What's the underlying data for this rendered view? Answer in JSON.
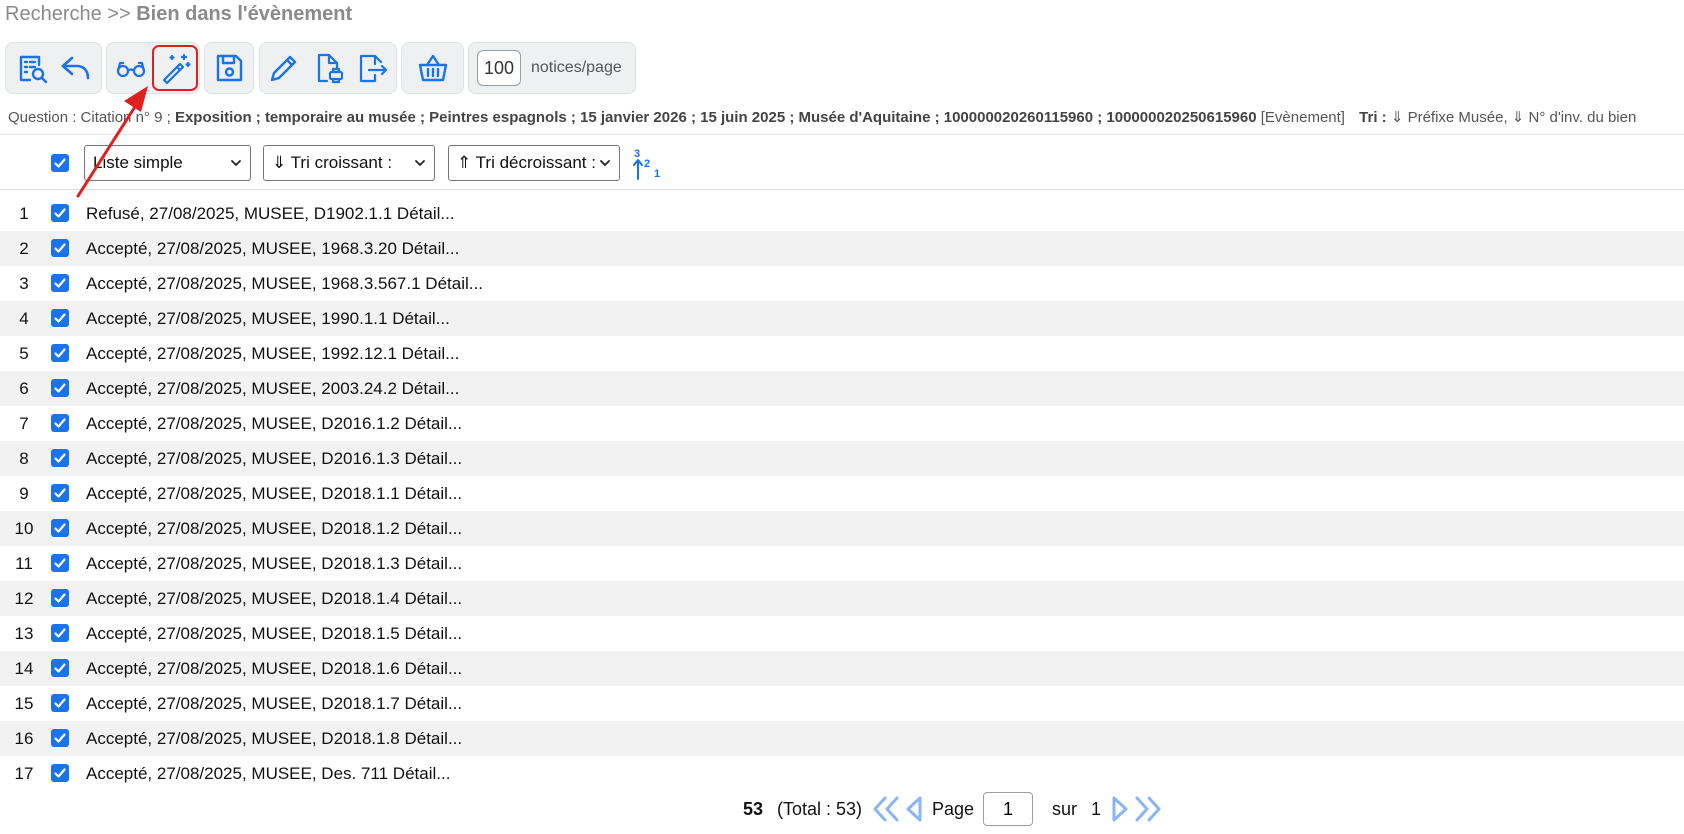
{
  "breadcrumb": {
    "root": "Recherche",
    "separator": ">>",
    "current": "Bien dans l'évènement"
  },
  "toolbar": {
    "icons": [
      "list-search-icon",
      "undo-icon",
      "glasses-icon",
      "magic-wand-icon",
      "save-icon",
      "pencil-icon",
      "file-print-icon",
      "export-icon",
      "basket-icon"
    ],
    "per_page_value": "100",
    "per_page_label": "notices/page"
  },
  "question": {
    "prefix": "Question : Citation n° 9 ;",
    "terms": "Exposition ; temporaire au musée ; Peintres espagnols ; 15 janvier 2026 ; 15 juin 2025 ; Musée d'Aquitaine ; 100000020260115960 ; 100000020250615960",
    "context": "[Evènement]",
    "tri_label": "Tri :",
    "tri_value": "⇓ Préfixe Musée, ⇓ N° d'inv. du bien"
  },
  "controls": {
    "display_select": "Liste simple",
    "sort_asc_select": "⇓ Tri croissant :",
    "sort_desc_select": "⇑ Tri décroissant :"
  },
  "rows": [
    {
      "num": "1",
      "text": "Refusé, 27/08/2025, MUSEE, D1902.1.1 Détail..."
    },
    {
      "num": "2",
      "text": "Accepté, 27/08/2025, MUSEE, 1968.3.20 Détail..."
    },
    {
      "num": "3",
      "text": "Accepté, 27/08/2025, MUSEE, 1968.3.567.1 Détail..."
    },
    {
      "num": "4",
      "text": "Accepté, 27/08/2025, MUSEE, 1990.1.1 Détail..."
    },
    {
      "num": "5",
      "text": "Accepté, 27/08/2025, MUSEE, 1992.12.1 Détail..."
    },
    {
      "num": "6",
      "text": "Accepté, 27/08/2025, MUSEE, 2003.24.2 Détail..."
    },
    {
      "num": "7",
      "text": "Accepté, 27/08/2025, MUSEE, D2016.1.2 Détail..."
    },
    {
      "num": "8",
      "text": "Accepté, 27/08/2025, MUSEE, D2016.1.3 Détail..."
    },
    {
      "num": "9",
      "text": "Accepté, 27/08/2025, MUSEE, D2018.1.1 Détail..."
    },
    {
      "num": "10",
      "text": "Accepté, 27/08/2025, MUSEE, D2018.1.2 Détail..."
    },
    {
      "num": "11",
      "text": "Accepté, 27/08/2025, MUSEE, D2018.1.3 Détail..."
    },
    {
      "num": "12",
      "text": "Accepté, 27/08/2025, MUSEE, D2018.1.4 Détail..."
    },
    {
      "num": "13",
      "text": "Accepté, 27/08/2025, MUSEE, D2018.1.5 Détail..."
    },
    {
      "num": "14",
      "text": "Accepté, 27/08/2025, MUSEE, D2018.1.6 Détail..."
    },
    {
      "num": "15",
      "text": "Accepté, 27/08/2025, MUSEE, D2018.1.7 Détail..."
    },
    {
      "num": "16",
      "text": "Accepté, 27/08/2025, MUSEE, D2018.1.8 Détail..."
    },
    {
      "num": "17",
      "text": "Accepté, 27/08/2025, MUSEE, Des. 711 Détail..."
    }
  ],
  "pager": {
    "count": "53",
    "total": "(Total : 53)",
    "page_label": "Page",
    "page_value": "1",
    "sur_label": "sur",
    "page_count": "1"
  },
  "colors": {
    "accent": "#1a73e8",
    "highlight": "#e02020",
    "row_alt": "#f2f2f2"
  }
}
